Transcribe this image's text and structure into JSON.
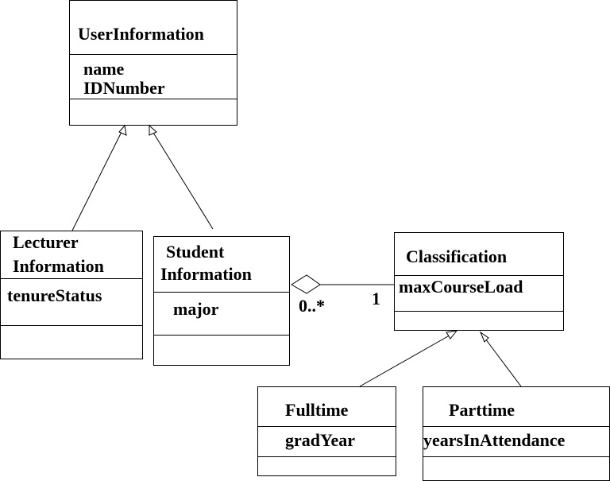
{
  "diagram": {
    "type": "UML class diagram",
    "classes": {
      "user_information": {
        "name": "UserInformation",
        "attributes": [
          "name",
          "IDNumber"
        ],
        "operations": []
      },
      "lecturer_information": {
        "name_line1": "Lecturer",
        "name_line2": "Information",
        "attributes": [
          "tenureStatus"
        ],
        "operations": []
      },
      "student_information": {
        "name_line1": "Student",
        "name_line2": "Information",
        "attributes": [
          "major"
        ],
        "operations": []
      },
      "classification": {
        "name": "Classification",
        "attributes": [
          "maxCourseLoad"
        ],
        "operations": []
      },
      "fulltime": {
        "name": "Fulltime",
        "attributes": [
          "gradYear"
        ],
        "operations": []
      },
      "parttime": {
        "name": "Parttime",
        "attributes": [
          "yearsInAttendance"
        ],
        "operations": []
      }
    },
    "relationships": [
      {
        "type": "generalization",
        "from": "LecturerInformation",
        "to": "UserInformation"
      },
      {
        "type": "generalization",
        "from": "StudentInformation",
        "to": "UserInformation"
      },
      {
        "type": "aggregation",
        "whole": "StudentInformation",
        "part": "Classification",
        "whole_multiplicity": "0..*",
        "part_multiplicity": "1"
      },
      {
        "type": "generalization",
        "from": "Fulltime",
        "to": "Classification"
      },
      {
        "type": "generalization",
        "from": "Parttime",
        "to": "Classification"
      }
    ],
    "multiplicities": {
      "student_end": "0..*",
      "classification_end": "1"
    }
  }
}
